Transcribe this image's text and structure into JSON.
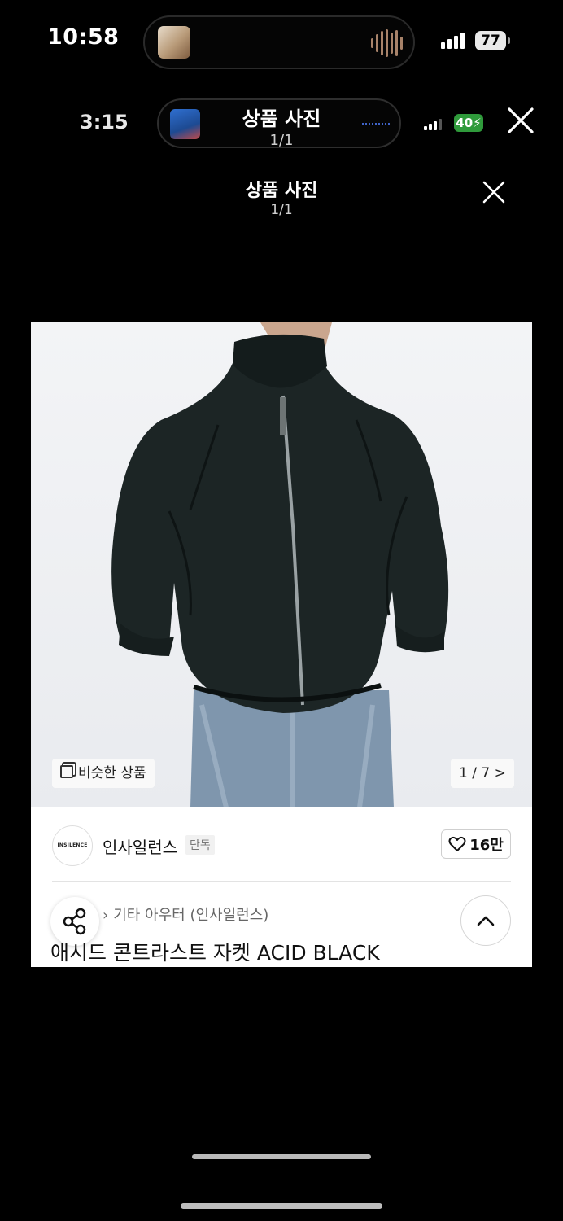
{
  "outer_status": {
    "time": "10:58",
    "battery": "77"
  },
  "inner_status": {
    "time": "3:15",
    "title": "상품 사진",
    "page": "1/1",
    "battery": "40"
  },
  "header": {
    "title": "상품 사진",
    "page": "1/1"
  },
  "product": {
    "similar_label": "비슷한 상품",
    "image_counter": "1 / 7 >",
    "brand_logo_text": "INSILENCE",
    "brand": "인사일런스",
    "exclusive_badge": "단독",
    "likes": "16만",
    "breadcrumb": "기타 아우터 (인사일런스)",
    "title": "애시드 콘트라스트 자켓 ACID BLACK"
  },
  "icons": [
    "close-icon",
    "heart-icon",
    "share-icon",
    "chevron-up-icon",
    "similar-icon"
  ],
  "colors": {
    "background": "#000000",
    "card": "#ffffff",
    "battery_green": "#2f9a3b"
  }
}
